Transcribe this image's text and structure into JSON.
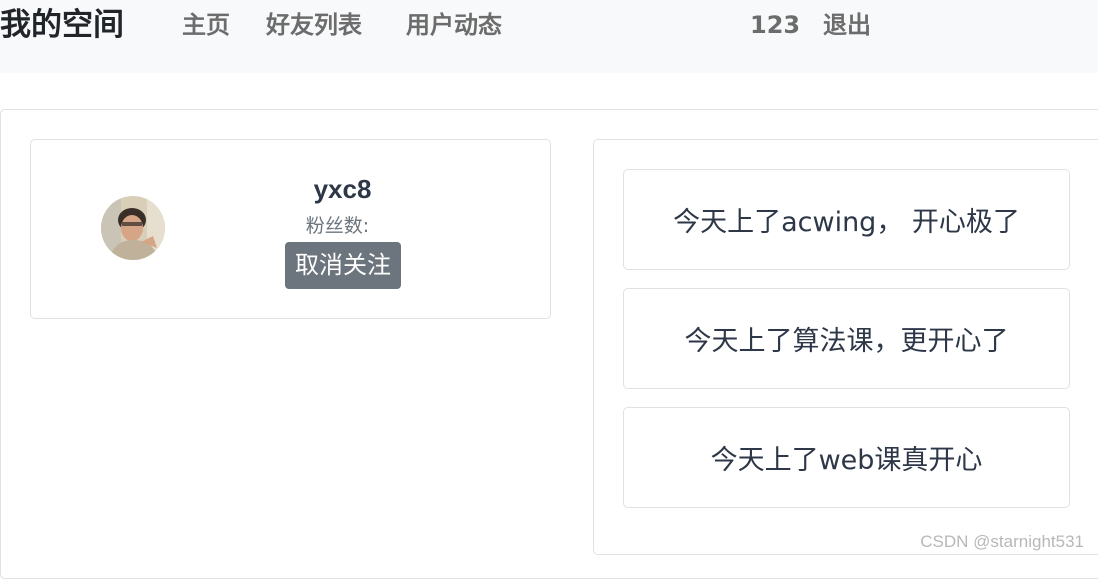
{
  "navbar": {
    "brand": "我的空间",
    "links": [
      "主页",
      "好友列表",
      "用户动态"
    ],
    "username": "123",
    "logout": "退出"
  },
  "profile": {
    "username": "yxc8",
    "fans_label": "粉丝数:",
    "unfollow_label": "取消关注"
  },
  "posts": [
    {
      "content": "今天上了acwing， 开心极了"
    },
    {
      "content": "今天上了算法课，更开心了"
    },
    {
      "content": "今天上了web课真开心"
    }
  ],
  "watermark": "CSDN @starnight531"
}
